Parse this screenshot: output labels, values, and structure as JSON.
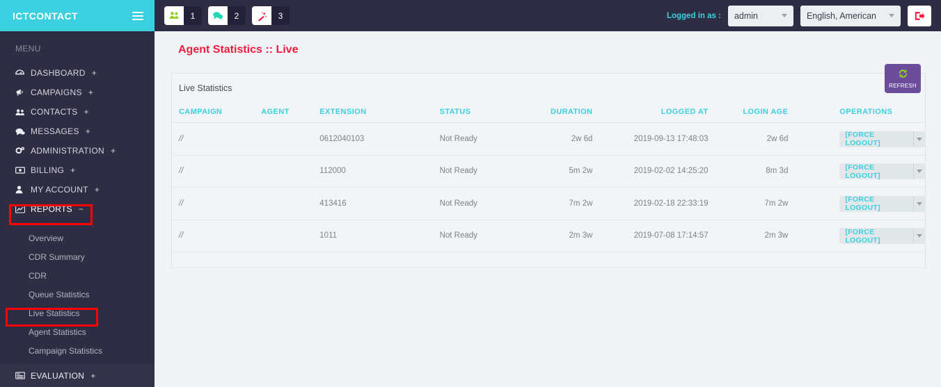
{
  "topbar": {
    "logo": "ICTCONTACT",
    "menu_toggle_icon": "hamburger-icon",
    "badges": [
      {
        "icon": "users-icon",
        "glyph": "👥",
        "color": "#8fd119",
        "count": "1"
      },
      {
        "icon": "chat-icon",
        "glyph": "💬",
        "color": "#1fd6b5",
        "count": "2"
      },
      {
        "icon": "magic-wand-icon",
        "glyph": "✦",
        "color": "#f21b3f",
        "count": "3"
      }
    ],
    "logged_in_label": "Logged in as :",
    "user_value": "admin",
    "language_value": "English, American",
    "logout_icon": "logout-icon"
  },
  "sidebar": {
    "menu_label": "MENU",
    "items": [
      {
        "label": "DASHBOARD",
        "icon": "dashboard-icon",
        "glyph": "⚙",
        "expander": "+"
      },
      {
        "label": "CAMPAIGNS",
        "icon": "megaphone-icon",
        "glyph": "📢",
        "expander": "+"
      },
      {
        "label": "CONTACTS",
        "icon": "contacts-icon",
        "glyph": "👥",
        "expander": "+"
      },
      {
        "label": "MESSAGES",
        "icon": "messages-icon",
        "glyph": "💬",
        "expander": "+"
      },
      {
        "label": "ADMINISTRATION",
        "icon": "gears-icon",
        "glyph": "⚙",
        "expander": "+"
      },
      {
        "label": "BILLING",
        "icon": "money-icon",
        "glyph": "💵",
        "expander": "+"
      },
      {
        "label": "MY ACCOUNT",
        "icon": "user-icon",
        "glyph": "👤",
        "expander": "+"
      },
      {
        "label": "REPORTS",
        "icon": "chart-line-icon",
        "glyph": "📈",
        "expander": "−"
      }
    ],
    "submenu": [
      {
        "label": "Overview"
      },
      {
        "label": "CDR Summary"
      },
      {
        "label": "CDR"
      },
      {
        "label": "Queue Statistics"
      },
      {
        "label": "Live Statistics"
      },
      {
        "label": "Agent Statistics"
      },
      {
        "label": "Campaign Statistics"
      }
    ],
    "evaluation": {
      "label": "EVALUATION",
      "icon": "list-icon",
      "glyph": "☰",
      "expander": "+"
    },
    "highlight_color": "#fe0000"
  },
  "main": {
    "page_title": "Agent Statistics :: Live",
    "panel_title": "Live Statistics",
    "refresh_button": {
      "label": "REFRESH",
      "icon": "refresh-icon",
      "glyph": "↻"
    },
    "table": {
      "columns": [
        "CAMPAIGN",
        "AGENT",
        "EXTENSION",
        "STATUS",
        "DURATION",
        "LOGGED AT",
        "LOGIN AGE",
        "OPERATIONS"
      ],
      "rows": [
        {
          "campaign": "//",
          "agent": "",
          "extension": "0612040103",
          "status": "Not Ready",
          "duration": "2w 6d",
          "logged_at": "2019-09-13 17:48:03",
          "login_age": "2w 6d",
          "operation": "[FORCE LOGOUT]"
        },
        {
          "campaign": "//",
          "agent": "",
          "extension": "112000",
          "status": "Not Ready",
          "duration": "5m 2w",
          "logged_at": "2019-02-02 14:25:20",
          "login_age": "8m 3d",
          "operation": "[FORCE LOGOUT]"
        },
        {
          "campaign": "//",
          "agent": "",
          "extension": "413416",
          "status": "Not Ready",
          "duration": "7m 2w",
          "logged_at": "2019-02-18 22:33:19",
          "login_age": "7m 2w",
          "operation": "[FORCE LOGOUT]"
        },
        {
          "campaign": "//",
          "agent": "",
          "extension": "1011",
          "status": "Not Ready",
          "duration": "2m 3w",
          "logged_at": "2019-07-08 17:14:57",
          "login_age": "2m 3w",
          "operation": "[FORCE LOGOUT]"
        }
      ]
    }
  },
  "colors": {
    "brand_cyan": "#3ccfe0",
    "sidebar_dark": "#2f2d44",
    "title_red": "#f21b3f",
    "refresh_purple": "#6b4d9b",
    "refresh_green": "#8fd119",
    "highlight_red": "#fe0000"
  }
}
